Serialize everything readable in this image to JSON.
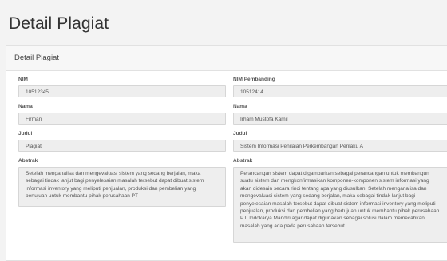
{
  "page": {
    "title": "Detail Plagiat"
  },
  "panel": {
    "heading": "Detail Plagiat",
    "left": {
      "nim_label": "NIM",
      "nim_value": "10512345",
      "nama_label": "Nama",
      "nama_value": "Firman",
      "judul_label": "Judul",
      "judul_value": "Plagiat",
      "abstrak_label": "Abstrak",
      "abstrak_value": "Setelah menganalisa dan mengevaluasi sistem yang sedang berjalan, maka sebagai tindak lanjut bagi penyelesaian masalah tersebut dapat dibuat sistem informasi inventory yang meliputi penjualan, produksi dan pembelian yang bertujuan untuk membantu pihak perusahaan PT"
    },
    "right": {
      "nim_label": "NIM Pembanding",
      "nim_value": "10512414",
      "nama_label": "Nama",
      "nama_value": "Irham Mustofa Kamil",
      "judul_label": "Judul",
      "judul_value": "Sistem Informasi Penilaian Perkembangan Perilaku A",
      "abstrak_label": "Abstrak",
      "abstrak_value": "Perancangan sistem dapat digambarkan sebagai perancangan untuk membangun suatu sistem dan mengkonfirmasikan komponen-komponen sistem informasi yang akan didesain secara rinci tentang apa yang diusulkan. Setelah menganalisa dan mengevaluasi sistem yang sedang berjalan, maka sebagai tindak lanjut bagi penyelesaian masalah tersebut dapat dibuat sistem informasi inventory yang meliputi penjualan, produksi dan pembelian yang bertujuan untuk membantu pihak perusahaan PT. Indokarya Mandiri agar dapat digunakan sebagai solusi dalam memecahkan masalah yang ada pada perusahaan tersebut."
    }
  }
}
